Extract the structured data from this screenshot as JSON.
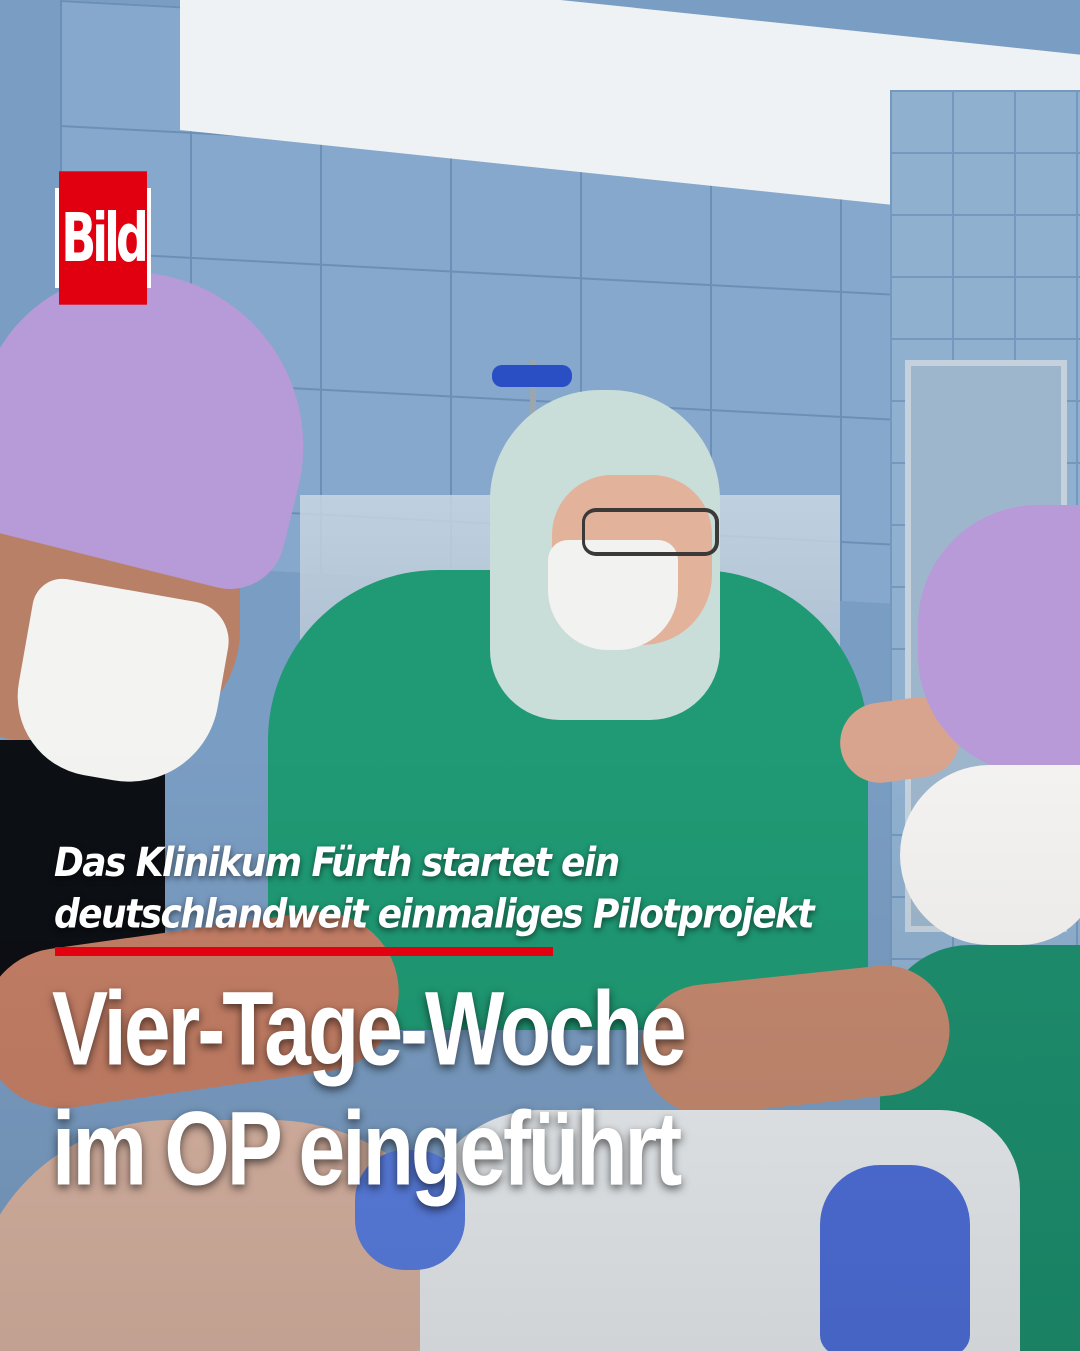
{
  "brand": {
    "logo_text": "Bild"
  },
  "story": {
    "kicker_line_1": "Das Klinikum Fürth startet ein",
    "kicker_line_2": "deutschlandweit einmaliges Pilotprojekt",
    "headline_line_1": "Vier-Tage-Woche",
    "headline_line_2": "im OP eingeführt"
  },
  "colors": {
    "brand_red": "#e3000f",
    "text": "#ffffff"
  }
}
